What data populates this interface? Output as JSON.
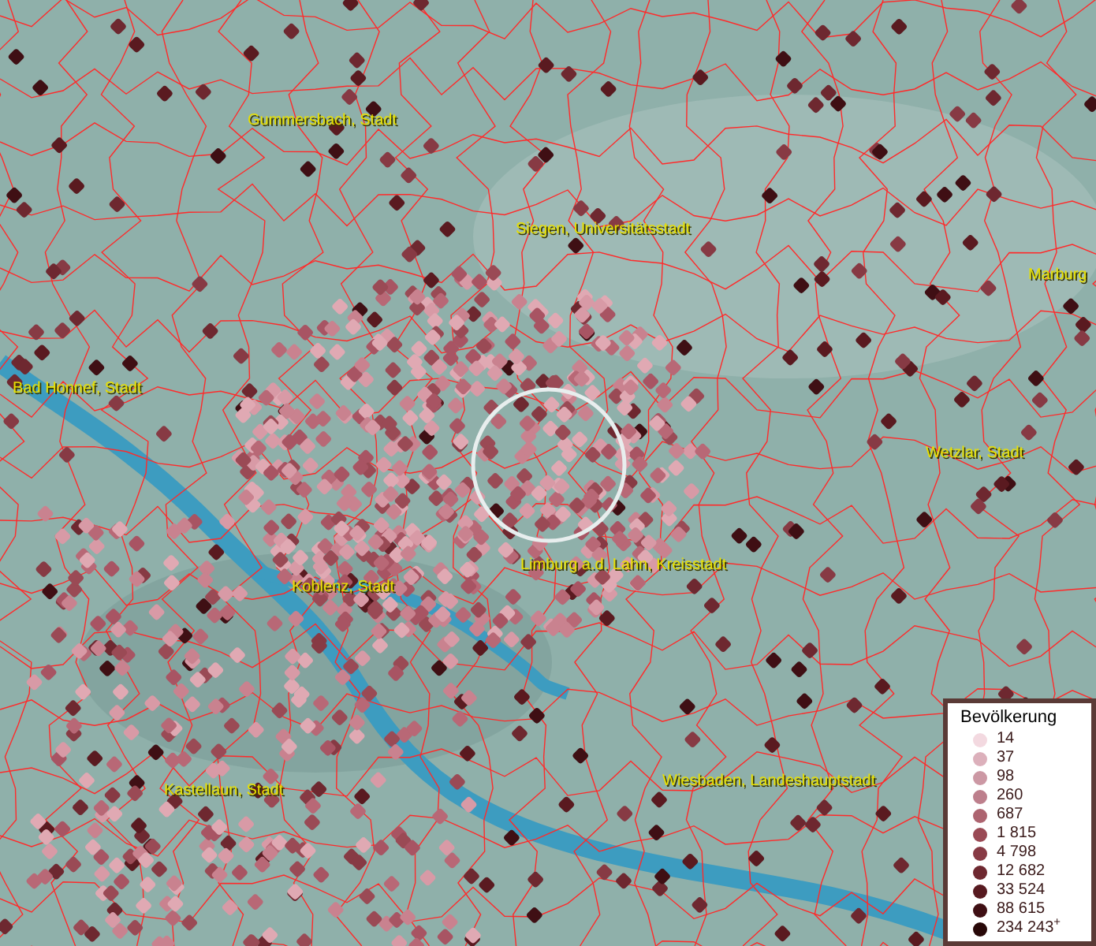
{
  "map": {
    "place_labels": [
      {
        "name": "Gummersbach, Stadt"
      },
      {
        "name": "Siegen, Universitätsstadt"
      },
      {
        "name": "Marburg"
      },
      {
        "name": "Bad Honnef, Stadt"
      },
      {
        "name": "Wetzlar, Stadt"
      },
      {
        "name": "Limburg a.d. Lahn, Kreisstadt"
      },
      {
        "name": "Koblenz, Stadt"
      },
      {
        "name": "Kastellaun, Stadt"
      },
      {
        "name": "Wiesbaden, Landeshauptstadt"
      }
    ]
  },
  "legend": {
    "title": "Bevölkerung",
    "items": [
      {
        "label": "14",
        "color": "#f3d9e0"
      },
      {
        "label": "37",
        "color": "#dcb0bb"
      },
      {
        "label": "98",
        "color": "#cc98a4"
      },
      {
        "label": "260",
        "color": "#bd7f8c"
      },
      {
        "label": "687",
        "color": "#ad6470"
      },
      {
        "label": "1 815",
        "color": "#9a4a55"
      },
      {
        "label": "4 798",
        "color": "#873a44"
      },
      {
        "label": "12 682",
        "color": "#6e2830"
      },
      {
        "label": "33 524",
        "color": "#571a20"
      },
      {
        "label": "88 615",
        "color": "#3f0f14"
      },
      {
        "label": "234 243$^{+}$",
        "color": "#280808"
      }
    ]
  }
}
